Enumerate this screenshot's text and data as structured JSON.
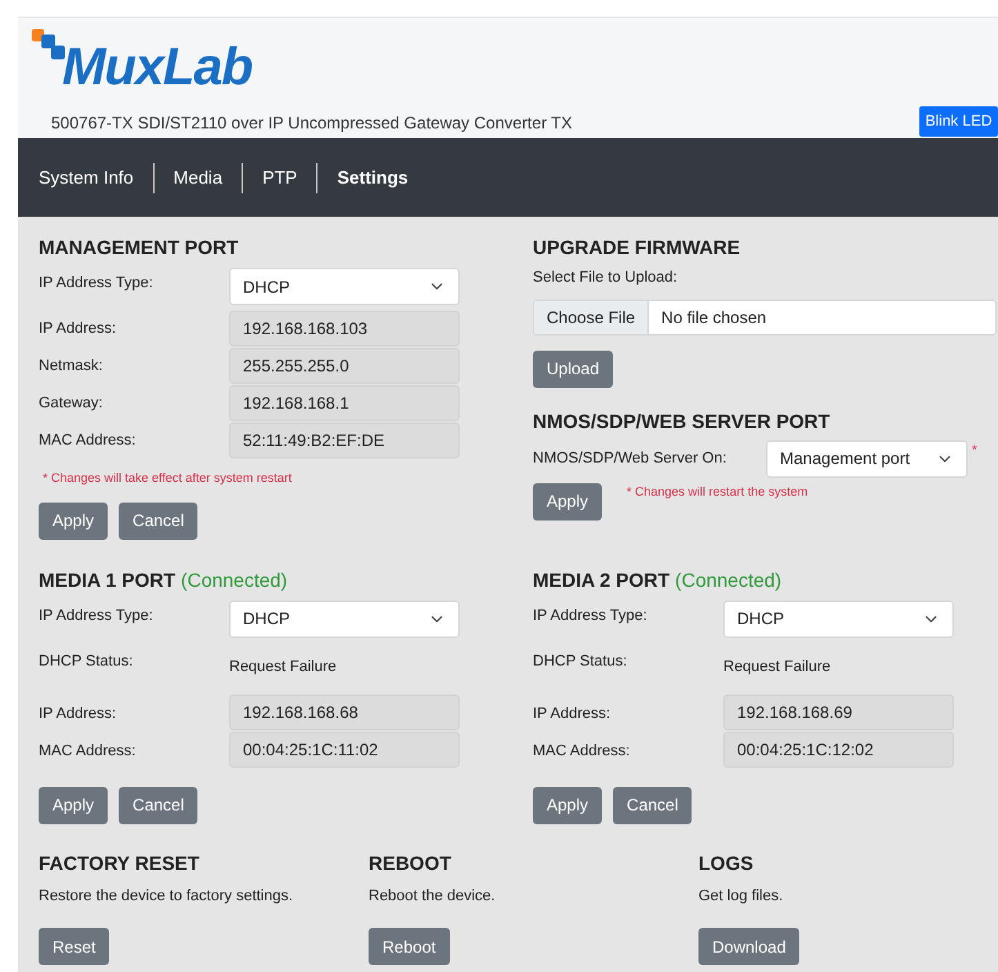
{
  "header": {
    "logo": "MuxLab",
    "subtitle": "500767-TX SDI/ST2110 over IP Uncompressed Gateway Converter TX",
    "blink_button": "Blink LED"
  },
  "nav": [
    {
      "label": "System Info",
      "selected": false
    },
    {
      "label": "Media",
      "selected": false
    },
    {
      "label": "PTP",
      "selected": false
    },
    {
      "label": "Settings",
      "selected": true
    }
  ],
  "management_port": {
    "title": "MANAGEMENT PORT",
    "fields": [
      {
        "label": "IP Address Type:",
        "kind": "select",
        "value": "DHCP"
      },
      {
        "label": "IP Address:",
        "kind": "readonly",
        "value": "192.168.168.103"
      },
      {
        "label": "Netmask:",
        "kind": "readonly",
        "value": "255.255.255.0"
      },
      {
        "label": "Gateway:",
        "kind": "readonly",
        "value": "192.168.168.1"
      },
      {
        "label": "MAC Address:",
        "kind": "readonly",
        "value": "52:11:49:B2:EF:DE"
      }
    ],
    "note": "* Changes will take effect after system restart",
    "buttons": [
      "Apply",
      "Cancel"
    ]
  },
  "upgrade_firmware": {
    "title": "UPGRADE FIRMWARE",
    "label": "Select File to Upload:",
    "choose_button": "Choose File",
    "file_status": "No file chosen",
    "button": "Upload"
  },
  "server_port": {
    "title": "NMOS/SDP/WEB SERVER PORT",
    "label": "NMOS/SDP/Web Server On:",
    "value": "Management port",
    "required_mark": "*",
    "button": "Apply",
    "note": "* Changes will restart the system"
  },
  "media_ports": [
    {
      "title": "MEDIA 1 PORT",
      "status": "(Connected)",
      "fields": [
        {
          "label": "IP Address Type:",
          "kind": "select",
          "value": "DHCP"
        },
        {
          "label": "DHCP Status:",
          "kind": "text",
          "value": "Request Failure"
        },
        {
          "label": "IP Address:",
          "kind": "readonly",
          "value": "192.168.168.68"
        },
        {
          "label": "MAC Address:",
          "kind": "readonly",
          "value": "00:04:25:1C:11:02"
        }
      ],
      "buttons": [
        "Apply",
        "Cancel"
      ]
    },
    {
      "title": "MEDIA 2 PORT",
      "status": "(Connected)",
      "fields": [
        {
          "label": "IP Address Type:",
          "kind": "select",
          "value": "DHCP"
        },
        {
          "label": "DHCP Status:",
          "kind": "text",
          "value": "Request Failure"
        },
        {
          "label": "IP Address:",
          "kind": "readonly",
          "value": "192.168.168.69"
        },
        {
          "label": "MAC Address:",
          "kind": "readonly",
          "value": "00:04:25:1C:12:02"
        }
      ],
      "buttons": [
        "Apply",
        "Cancel"
      ]
    }
  ],
  "actions": [
    {
      "title": "FACTORY RESET",
      "description": "Restore the device to factory settings.",
      "button": "Reset"
    },
    {
      "title": "REBOOT",
      "description": "Reboot the device.",
      "button": "Reboot"
    },
    {
      "title": "LOGS",
      "description": "Get log files.",
      "button": "Download"
    }
  ]
}
